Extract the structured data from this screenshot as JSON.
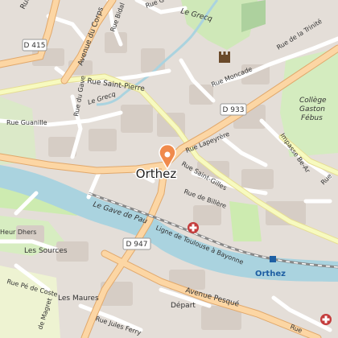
{
  "labels": {
    "city": "Orthez",
    "station": "Orthez",
    "rue_des_b": "Rue des B",
    "avenue_corps": "Avenue du Corps",
    "rue_bidal": "Rue Bidal",
    "rue_gre": "Rue G",
    "le_grecq_top": "Le Grecq",
    "rue_trinite": "Rue de la Trinité",
    "rue_moncade": "Rue Moncade",
    "rue_saint_pierre": "Rue Saint-Pierre",
    "rue_du_gave": "Rue du Gave",
    "le_grecq_mid": "Le Grecq",
    "rue_guanille": "Rue Guanille",
    "college": [
      "Collège",
      "Gaston",
      "Fébus"
    ],
    "impasse": "Impasse Be-Ar",
    "rue_lapeyrere": "Rue Lapeyrère",
    "rue_saint_gilles": "Rue Saint-Gilles",
    "rue_billere": "Rue de Billère",
    "rue_right_edge": "Rue",
    "le_gave_de_pau": "Le Gave de Pau",
    "ligne_toulouse": "Ligne de Toulouse à Bayonne",
    "heur_dhers": "Heur Dhers",
    "les_sources": "Les Sources",
    "rue_pe_de_coste": "Rue Pé de Coste",
    "avenue_magret": "de Magret",
    "les_maures": "Les Maures",
    "avenue_pesque": "Avenue Pesqué",
    "depart": "Départ",
    "rue_jules_ferry": "Rue Jules Ferry",
    "rue_bottom": "Rue"
  },
  "road_shields": {
    "d415": "D 415",
    "d933": "D 933",
    "d947": "D 947"
  },
  "colors": {
    "background": "#f2efe9",
    "urban": "#e0dcd6",
    "building": "#d9d0c9",
    "park": "#cdebb0",
    "forest": "#add19e",
    "water": "#aad3df",
    "primary_road": "#fcd6a4",
    "main_road": "#f7fabf",
    "pin": "#f08a4b",
    "hospital": "#c43c3c"
  },
  "icons": {
    "marker": "map-pin-icon",
    "castle": "castle-icon",
    "hospital": "hospital-icon",
    "station": "train-station-icon"
  }
}
